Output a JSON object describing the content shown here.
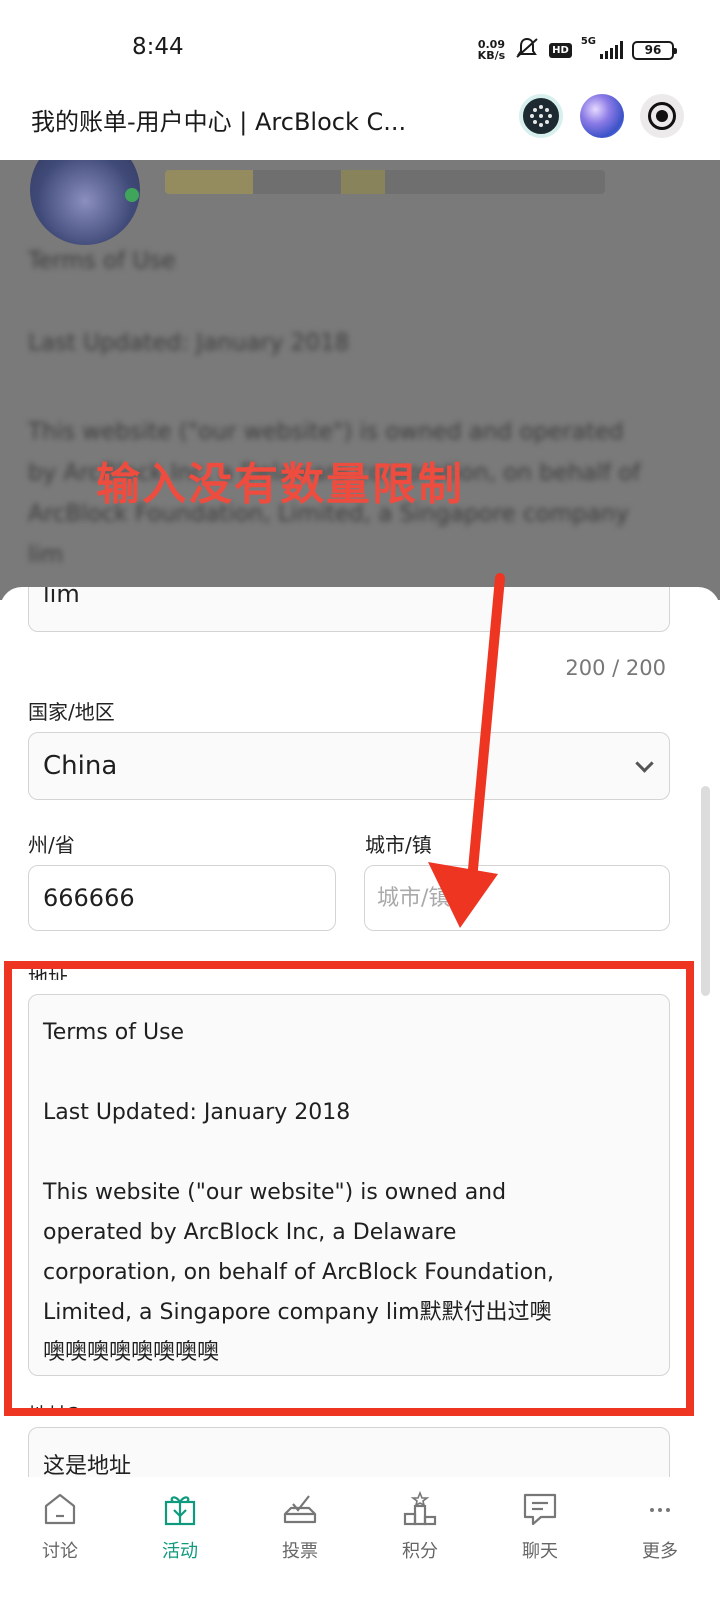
{
  "status_bar": {
    "time": "8:44",
    "net_speed_value": "0.09",
    "net_speed_unit": "KB/s",
    "hd": "HD",
    "network": "5G",
    "battery": "96"
  },
  "title_bar": {
    "title": "我的账单-用户中心 | ArcBlock C..."
  },
  "background_page": {
    "heading": "Terms of Use",
    "updated": "Last Updated: January 2018",
    "paragraph": "This website (\"our website\") is owned and operated by ArcBlock Inc, a Delaware corporation, on behalf of ArcBlock Foundation, Limited, a Singapore company lim"
  },
  "annotation": {
    "text": "输入没有数量限制",
    "color": "#ee4c3f"
  },
  "form": {
    "top_field_value": "lim",
    "top_field_counter": "200 / 200",
    "country_label": "国家/地区",
    "country_value": "China",
    "state_label": "州/省",
    "state_value": "666666",
    "city_label": "城市/镇",
    "city_placeholder": "城市/镇",
    "address_label": "地址",
    "address_lines": [
      "Terms of Use",
      "Last Updated: January 2018",
      "This website (\"our website\") is owned and",
      "operated by ArcBlock Inc, a Delaware",
      "corporation, on behalf of ArcBlock Foundation,",
      "Limited, a Singapore company lim默默付出过噢",
      "噢噢噢噢噢噢噢噢"
    ],
    "address2_label": "地址2",
    "address2_placeholder": "这是地址"
  },
  "bottom_nav": [
    {
      "label": "讨论",
      "icon": "home-icon"
    },
    {
      "label": "活动",
      "icon": "gift-icon",
      "active": true
    },
    {
      "label": "投票",
      "icon": "vote-icon"
    },
    {
      "label": "积分",
      "icon": "podium-icon"
    },
    {
      "label": "聊天",
      "icon": "chat-icon"
    },
    {
      "label": "更多",
      "icon": "more-icon"
    }
  ],
  "colors": {
    "accent": "#0f9a7e",
    "highlight": "#ee3521"
  }
}
